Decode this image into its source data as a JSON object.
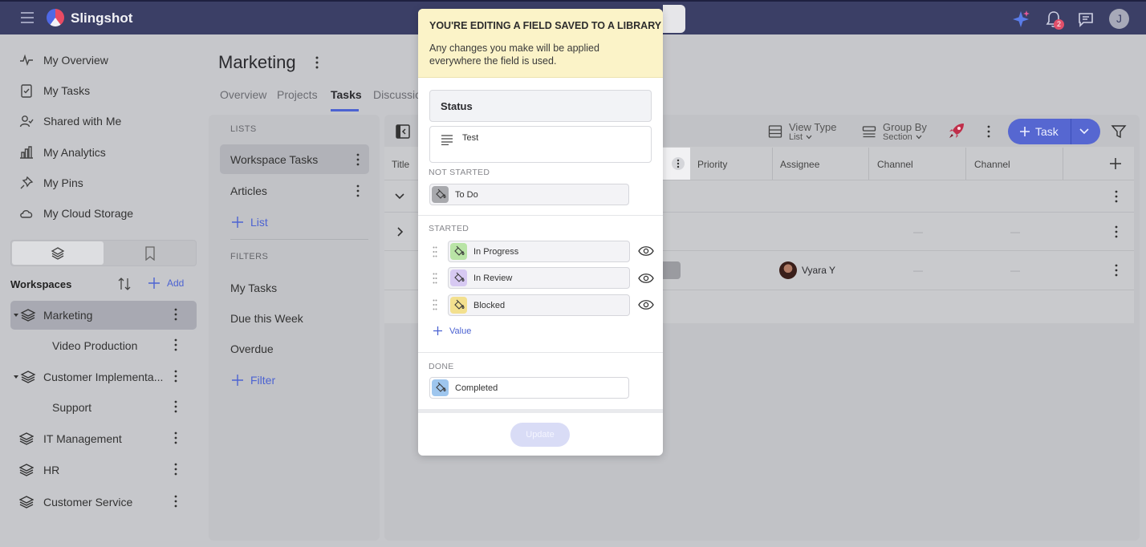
{
  "app": {
    "name": "Slingshot"
  },
  "notifications": {
    "count": "2"
  },
  "user": {
    "initial": "J"
  },
  "sidebar": {
    "nav": [
      {
        "label": "My Overview",
        "icon": "pulse-icon"
      },
      {
        "label": "My Tasks",
        "icon": "clipboard-check-icon"
      },
      {
        "label": "Shared with Me",
        "icon": "user-share-icon"
      },
      {
        "label": "My Analytics",
        "icon": "bar-chart-icon"
      },
      {
        "label": "My Pins",
        "icon": "pin-icon"
      },
      {
        "label": "My Cloud Storage",
        "icon": "cloud-icon"
      }
    ],
    "workspaces_label": "Workspaces",
    "add_label": "Add",
    "workspaces": [
      {
        "label": "Marketing",
        "active": true
      },
      {
        "label": "Video Production"
      },
      {
        "label": "Customer Implementa..."
      },
      {
        "label": "Support"
      },
      {
        "label": "IT Management"
      },
      {
        "label": "HR"
      },
      {
        "label": "Customer Service"
      }
    ]
  },
  "page": {
    "title": "Marketing",
    "tabs": [
      "Overview",
      "Projects",
      "Tasks",
      "Discussio"
    ],
    "active_tab": "Tasks"
  },
  "lists_panel": {
    "lists_heading": "LISTS",
    "lists": [
      "Workspace Tasks",
      "Articles"
    ],
    "add_list": "List",
    "filters_heading": "FILTERS",
    "filters": [
      "My Tasks",
      "Due this Week",
      "Overdue"
    ],
    "add_filter": "Filter"
  },
  "toolbar": {
    "view_type_label": "View Type",
    "view_type_value": "List",
    "group_by_label": "Group By",
    "group_by_value": "Section",
    "task_button": "Task"
  },
  "table": {
    "columns": [
      "Title",
      "Priority",
      "Assignee",
      "Channel",
      "Channel"
    ],
    "row_assignee": "Vyara Y",
    "empty_cell": "—"
  },
  "modal": {
    "banner_title": "YOU'RE EDITING A FIELD SAVED TO A LIBRARY",
    "banner_text": "Any changes you make will be applied everywhere the field is used.",
    "field_name": "Status",
    "field_description": "Test",
    "groups": {
      "not_started": "NOT STARTED",
      "started": "STARTED",
      "done": "DONE"
    },
    "options": {
      "to_do": {
        "label": "To Do",
        "color": "#a8a9ad"
      },
      "in_progress": {
        "label": "In Progress",
        "color": "#b9e4a6"
      },
      "in_review": {
        "label": "In Review",
        "color": "#d7c9f2"
      },
      "blocked": {
        "label": "Blocked",
        "color": "#f3e08e"
      },
      "completed": {
        "label": "Completed",
        "color": "#9ec6ee"
      }
    },
    "add_value": "Value",
    "update_button": "Update"
  },
  "colors": {
    "accent": "#4c63d2",
    "topbar": "#3b3f66"
  }
}
